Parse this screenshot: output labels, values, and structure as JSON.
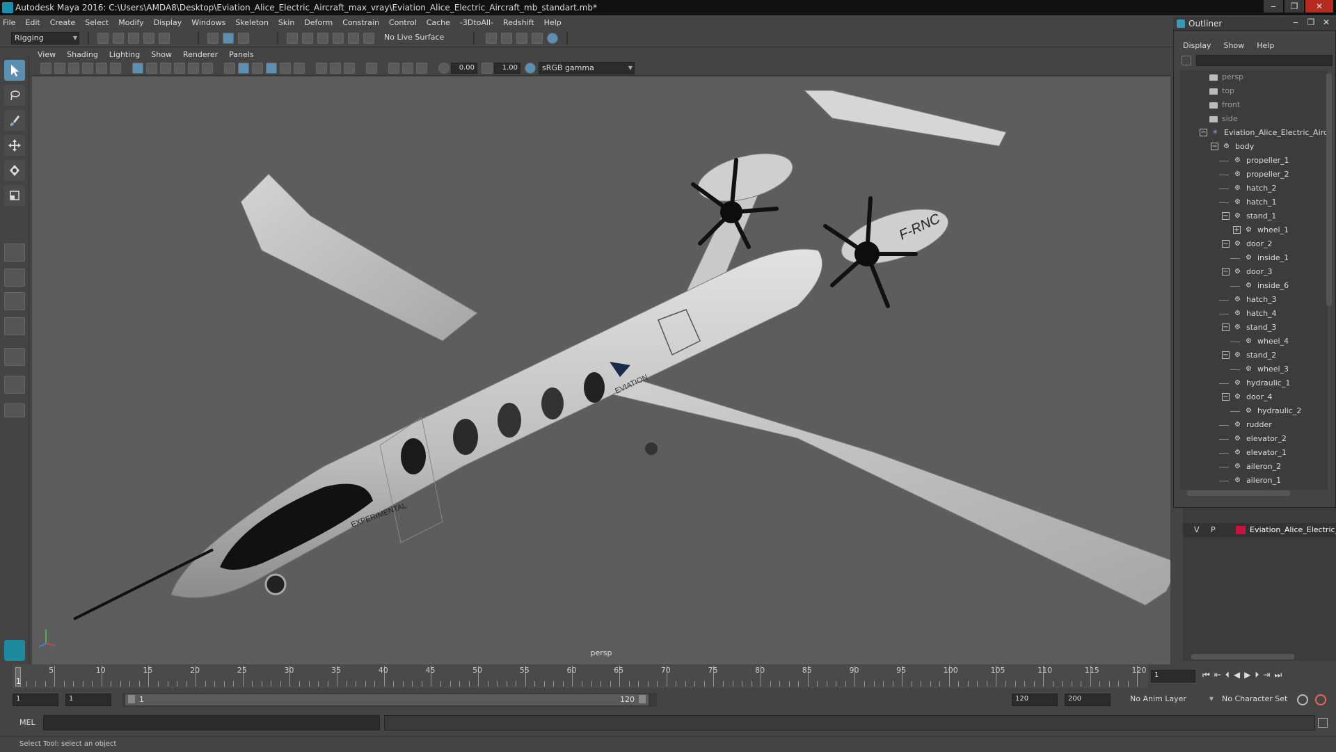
{
  "window": {
    "title": "Autodesk Maya 2016: C:\\Users\\AMDA8\\Desktop\\Eviation_Alice_Electric_Aircraft_max_vray\\Eviation_Alice_Electric_Aircraft_mb_standart.mb*",
    "minimize": "‒",
    "restore": "❐",
    "close": "✕"
  },
  "menubar": [
    "File",
    "Edit",
    "Create",
    "Select",
    "Modify",
    "Display",
    "Windows",
    "Skeleton",
    "Skin",
    "Deform",
    "Constrain",
    "Control",
    "Cache",
    "-3DtoAll-",
    "Redshift",
    "Help"
  ],
  "statusline": {
    "mode": "Rigging",
    "live_surface": "No Live Surface"
  },
  "viewport": {
    "menu": [
      "View",
      "Shading",
      "Lighting",
      "Show",
      "Renderer",
      "Panels"
    ],
    "exposure": "0.00",
    "gamma": "1.00",
    "color_space": "sRGB gamma",
    "camera_label": "persp",
    "model_labels": {
      "experimental": "EXPERIMENTAL",
      "eviation": "EVIATION",
      "tail": "F-RNC"
    }
  },
  "outliner": {
    "title": "Outliner",
    "menu": [
      "Display",
      "Show",
      "Help"
    ],
    "items": [
      {
        "label": "persp",
        "type": "camera",
        "depth": 0
      },
      {
        "label": "top",
        "type": "camera",
        "depth": 0
      },
      {
        "label": "front",
        "type": "camera",
        "depth": 0
      },
      {
        "label": "side",
        "type": "camera",
        "depth": 0
      },
      {
        "label": "Eviation_Alice_Electric_Aircraft",
        "type": "root",
        "depth": 0,
        "expander": "minus"
      },
      {
        "label": "body",
        "type": "transform",
        "depth": 1,
        "expander": "minus"
      },
      {
        "label": "propeller_1",
        "type": "transform",
        "depth": 2
      },
      {
        "label": "propeller_2",
        "type": "transform",
        "depth": 2
      },
      {
        "label": "hatch_2",
        "type": "transform",
        "depth": 2
      },
      {
        "label": "hatch_1",
        "type": "transform",
        "depth": 2
      },
      {
        "label": "stand_1",
        "type": "transform",
        "depth": 2,
        "expander": "minus"
      },
      {
        "label": "wheel_1",
        "type": "transform",
        "depth": 3,
        "expander": "plus"
      },
      {
        "label": "door_2",
        "type": "transform",
        "depth": 2,
        "expander": "minus"
      },
      {
        "label": "inside_1",
        "type": "transform",
        "depth": 3
      },
      {
        "label": "door_3",
        "type": "transform",
        "depth": 2,
        "expander": "minus"
      },
      {
        "label": "inside_6",
        "type": "transform",
        "depth": 3
      },
      {
        "label": "hatch_3",
        "type": "transform",
        "depth": 2
      },
      {
        "label": "hatch_4",
        "type": "transform",
        "depth": 2
      },
      {
        "label": "stand_3",
        "type": "transform",
        "depth": 2,
        "expander": "minus"
      },
      {
        "label": "wheel_4",
        "type": "transform",
        "depth": 3
      },
      {
        "label": "stand_2",
        "type": "transform",
        "depth": 2,
        "expander": "minus"
      },
      {
        "label": "wheel_3",
        "type": "transform",
        "depth": 3
      },
      {
        "label": "hydraulic_1",
        "type": "transform",
        "depth": 2
      },
      {
        "label": "door_4",
        "type": "transform",
        "depth": 2,
        "expander": "minus"
      },
      {
        "label": "hydraulic_2",
        "type": "transform",
        "depth": 3
      },
      {
        "label": "rudder",
        "type": "transform",
        "depth": 2
      },
      {
        "label": "elevator_2",
        "type": "transform",
        "depth": 2
      },
      {
        "label": "elevator_1",
        "type": "transform",
        "depth": 2
      },
      {
        "label": "aileron_2",
        "type": "transform",
        "depth": 2
      },
      {
        "label": "aileron_1",
        "type": "transform",
        "depth": 2
      }
    ]
  },
  "layers": {
    "visible": "V",
    "playback": "P",
    "layer_name": "Eviation_Alice_Electric_",
    "layer_color": "#c8143c"
  },
  "timeline": {
    "ticks": [
      "5",
      "10",
      "15",
      "20",
      "25",
      "30",
      "35",
      "40",
      "45",
      "50",
      "55",
      "60",
      "65",
      "70",
      "75",
      "80",
      "85",
      "90",
      "95",
      "100",
      "105",
      "110",
      "115",
      "120"
    ],
    "current_frame_marker": "1",
    "current_frame": "1"
  },
  "range": {
    "start": "1",
    "playback_start": "1",
    "slider_start": "1",
    "slider_end": "120",
    "playback_end": "120",
    "end": "200",
    "anim_layer": "No Anim Layer",
    "character_set": "No Character Set"
  },
  "cmdline": {
    "lang": "MEL"
  },
  "helpline": "Select Tool: select an object",
  "colors": {
    "accent": "#5d8fb5",
    "viewport_bg": "#5d5d5d",
    "panel_bg": "#444444"
  }
}
